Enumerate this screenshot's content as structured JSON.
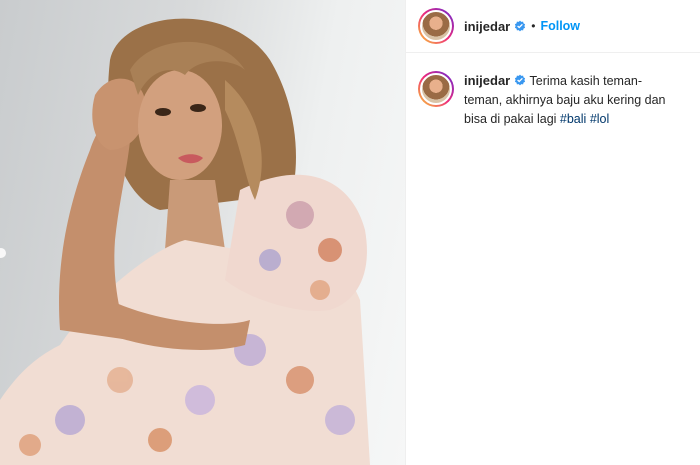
{
  "post": {
    "header": {
      "username": "inijedar",
      "verified_icon": "verified-badge-icon",
      "separator": "•",
      "follow_label": "Follow"
    },
    "caption": {
      "username": "inijedar",
      "text": "Terima kasih teman-teman, akhirnya baju aku kering dan bisa di pakai lagi",
      "hashtags": [
        "#bali",
        "#lol"
      ]
    },
    "colors": {
      "follow_blue": "#0095f6",
      "hashtag_blue": "#00376b",
      "verified_blue": "#3897f0"
    }
  }
}
